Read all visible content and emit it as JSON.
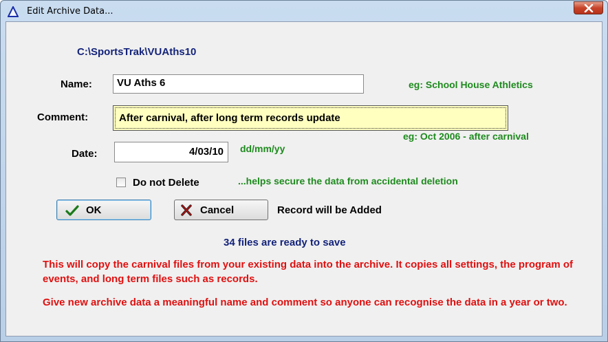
{
  "window": {
    "title": "Edit Archive Data...",
    "close_label": "x"
  },
  "path": "C:\\SportsTrak\\VUAths10",
  "name": {
    "label": "Name:",
    "value": "VU Aths 6",
    "hint": "eg: School House Athletics"
  },
  "comment": {
    "label": "Comment:",
    "value": "After carnival, after long term records update",
    "hint": "eg: Oct 2006 - after carnival"
  },
  "date": {
    "label": "Date:",
    "value": "4/03/10",
    "hint": "dd/mm/yy"
  },
  "do_not_delete": {
    "label": "Do not Delete",
    "checked": false,
    "hint": "...helps secure the data from accidental deletion"
  },
  "buttons": {
    "ok": "OK",
    "cancel": "Cancel"
  },
  "record_status": "Record will be Added",
  "files_status": "34 files are ready to save",
  "info": [
    "This will copy the carnival files from your existing data into the archive.  It copies all settings, the program of events, and long term files such as records.",
    "Give new archive data a meaningful name and comment so anyone can recognise the data in a year or two."
  ],
  "colors": {
    "green": "#1e8a1e",
    "red": "#e01010",
    "path_blue": "#14247a",
    "comment_bg": "#ffffc0"
  }
}
